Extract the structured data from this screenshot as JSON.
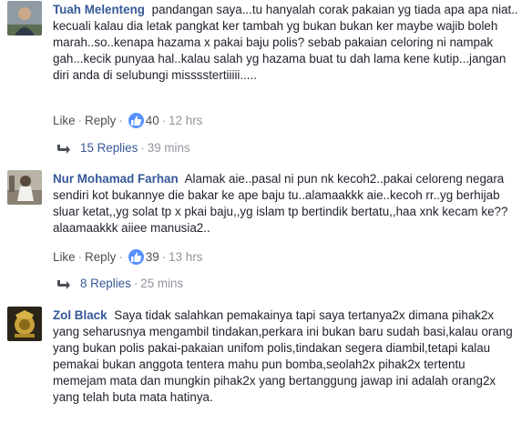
{
  "comments": [
    {
      "author": "Tuah Melenteng",
      "text": "pandangan saya...tu hanyalah corak pakaian yg tiada apa apa niat..\nkecuali kalau dia letak pangkat ker tambah yg bukan bukan ker maybe wajib boleh marah..so..kenapa hazama x pakai baju polis? sebab pakaian celoring ni nampak gah...kecik punyaa hal..kalau salah yg hazama buat tu dah lama kene kutip...jangan diri anda di selubungi misssstertiiiii.....",
      "like": "Like",
      "reply": "Reply",
      "reactions": "40",
      "time": "12 hrs",
      "replies_label": "15 Replies",
      "replies_time": "39 mins",
      "avatar": "person-avatar-1"
    },
    {
      "author": "Nur Mohamad Farhan",
      "text": "Alamak aie..pasal ni pun nk kecoh2..pakai celoreng negara sendiri kot bukannye die bakar ke ape baju tu..alamaakkk aie..kecoh rr..yg berhijab sluar ketat,,yg solat tp x pkai baju,,yg islam tp bertindik bertatu,,haa xnk kecam ke??alaamaakkk aiiee manusia2..",
      "like": "Like",
      "reply": "Reply",
      "reactions": "39",
      "time": "13 hrs",
      "replies_label": "8 Replies",
      "replies_time": "25 mins",
      "avatar": "person-avatar-2"
    },
    {
      "author": "Zol Black",
      "text": "Saya tidak salahkan pemakainya tapi saya tertanya2x dimana pihak2x yang seharusnya mengambil tindakan,perkara ini bukan baru sudah basi,kalau orang yang bukan polis pakai-pakaian unifom polis,tindakan segera diambil,tetapi kalau pemakai bukan anggota tentera mahu pun bomba,seolah2x pihak2x tertentu memejam mata dan mungkin pihak2x yang bertanggung jawap ini adalah orang2x yang telah buta mata hatinya.",
      "avatar": "emblem-avatar"
    }
  ],
  "separator": "·",
  "colors": {
    "author": "#365899",
    "meta": "#90949c",
    "reaction": "#5890ff"
  }
}
